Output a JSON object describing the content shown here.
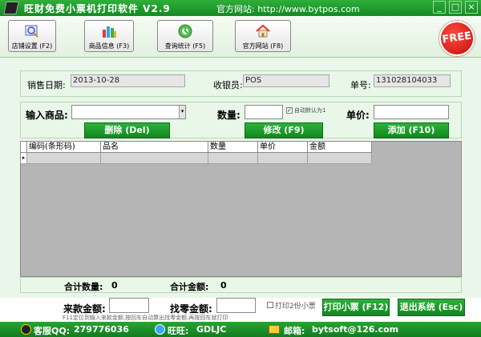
{
  "window": {
    "title": "旺财免费小票机打印软件 V2.9",
    "site_label": "官方网站: http://www.bytpos.com",
    "btn_min": "_",
    "btn_max": "□",
    "btn_close": "×"
  },
  "toolbar": {
    "buttons": [
      {
        "label": "店铺设置 (F2)"
      },
      {
        "label": "商品信息 (F3)"
      },
      {
        "label": "查询统计 (F5)"
      },
      {
        "label": "官方网站 (F8)"
      }
    ],
    "badge": "FREE"
  },
  "info": {
    "date_label": "销售日期:",
    "date_value": "2013-10-28",
    "cashier_label": "收银员:",
    "cashier_value": "POS",
    "order_label": "单号:",
    "order_value": "131028104033"
  },
  "entry": {
    "product_label": "输入商品:",
    "qty_label": "数量:",
    "auto_default_label": "自动默认为1",
    "auto_default_checked": true,
    "price_label": "单价:",
    "delete_button": "删除 (Del)",
    "modify_button": "修改 (F9)",
    "add_button": "添加 (F10)"
  },
  "table": {
    "columns": [
      "编码(条形码)",
      "品名",
      "数量",
      "单价",
      "金额"
    ],
    "rows": [
      [
        "",
        "",
        "",
        "",
        ""
      ]
    ]
  },
  "totals": {
    "qty_label": "合计数量:",
    "qty_value": "0",
    "amount_label": "合计金额:",
    "amount_value": "0"
  },
  "payment": {
    "received_label": "来款金额:",
    "change_label": "找零金额:",
    "print_two_label": "打印2份小票",
    "print_two_checked": false,
    "print_button": "打印小票 (F12)",
    "exit_button": "退出系统 (Esc)",
    "hint": "F11定位到输入来款金额,按回车自动算出找零金额,再按回车就打印"
  },
  "status": {
    "qq_label": "客服QQ:",
    "qq_value": "279776036",
    "wangwang_label": "旺旺:",
    "wangwang_value": "GDLJC",
    "email_label": "邮箱:",
    "email_value": "bytsoft@126.com"
  },
  "colors": {
    "accent_green": "#1a9a2a",
    "panel_green": "#e8f7e8",
    "free_red": "#d41414"
  },
  "icons": [
    "app-logo-icon",
    "shop-settings-icon",
    "product-info-icon",
    "stats-icon",
    "website-home-icon",
    "qq-penguin-icon",
    "wangwang-icon",
    "mail-icon"
  ]
}
